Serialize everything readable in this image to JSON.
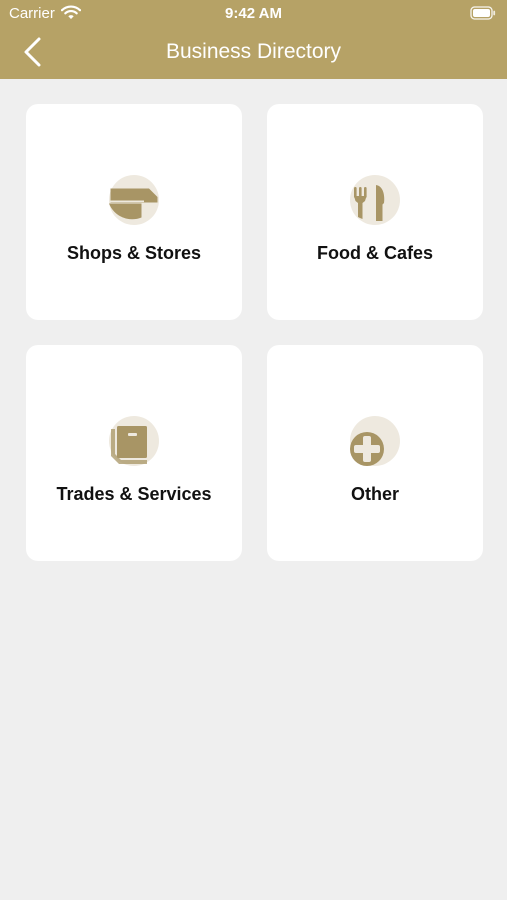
{
  "status_bar": {
    "carrier": "Carrier",
    "time": "9:42 AM",
    "wifi_icon": "wifi-icon",
    "battery_icon": "battery-icon"
  },
  "nav": {
    "title": "Business Directory",
    "back_icon": "chevron-left-icon"
  },
  "categories": [
    {
      "label": "Shops & Stores",
      "icon": "storefront-icon"
    },
    {
      "label": "Food & Cafes",
      "icon": "fork-knife-icon"
    },
    {
      "label": "Trades & Services",
      "icon": "toolbox-icon"
    },
    {
      "label": "Other",
      "icon": "plus-circle-icon"
    }
  ],
  "colors": {
    "header": "#b6a266",
    "accent": "#a89565",
    "icon_bg": "#eee9df",
    "background": "#efefef",
    "card": "#ffffff"
  }
}
